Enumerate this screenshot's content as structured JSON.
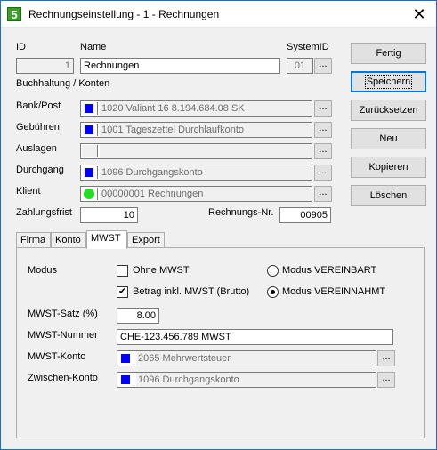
{
  "window": {
    "app_icon_text": "5",
    "title": "Rechnungseinstellung - 1 -  Rechnungen",
    "close_glyph": "✕"
  },
  "header": {
    "id_label": "ID",
    "id_value": "1",
    "name_label": "Name",
    "name_value": "Rechnungen",
    "systemid_label": "SystemID",
    "systemid_value": "01",
    "browse_glyph": "...",
    "section_label": "Buchhaltung / Konten"
  },
  "accounts": [
    {
      "label": "Bank/Post",
      "value": "1020 Valiant 16 8.194.684.08 SK",
      "marker": "blue-square"
    },
    {
      "label": "Gebühren",
      "value": "1001 Tageszettel Durchlaufkonto",
      "marker": "blue-square"
    },
    {
      "label": "Auslagen",
      "value": "",
      "marker": "empty"
    },
    {
      "label": "Durchgang",
      "value": "1096 Durchgangskonto",
      "marker": "blue-square"
    },
    {
      "label": "Klient",
      "value": "00000001 Rechnungen",
      "marker": "green-dot"
    }
  ],
  "footer_fields": {
    "zahlungsfrist_label": "Zahlungsfrist",
    "zahlungsfrist_value": "10",
    "rechnungsnr_label": "Rechnungs-Nr.",
    "rechnungsnr_value": "00905"
  },
  "buttons": {
    "fertig": "Fertig",
    "speichern": "Speichern",
    "zuruecksetzen": "Zurücksetzen",
    "neu": "Neu",
    "kopieren": "Kopieren",
    "loeschen": "Löschen"
  },
  "tabs": [
    "Firma",
    "Konto",
    "MWST",
    "Export"
  ],
  "active_tab": "MWST",
  "mwst": {
    "modus_label": "Modus",
    "ohne_mwst_label": "Ohne MWST",
    "ohne_mwst_checked": false,
    "betrag_inkl_label": "Betrag inkl. MWST (Brutto)",
    "betrag_inkl_checked": true,
    "modus_vereinbart_label": "Modus VEREINBART",
    "modus_vereinnahmt_label": "Modus VEREINNAHMT",
    "modus_selected": "VEREINNAHMT",
    "satz_label": "MWST-Satz (%)",
    "satz_value": "8.00",
    "nummer_label": "MWST-Nummer",
    "nummer_value": "CHE-123.456.789 MWST",
    "konto_label": "MWST-Konto",
    "konto_value": "2065 Mehrwertsteuer",
    "zwischen_label": "Zwischen-Konto",
    "zwischen_value": "1096 Durchgangskonto"
  },
  "colors": {
    "account_marker_blue": "#0000ff",
    "klient_marker_green": "#22dd22",
    "focus_border": "#0078d7",
    "app_icon": "#3aa02a"
  }
}
